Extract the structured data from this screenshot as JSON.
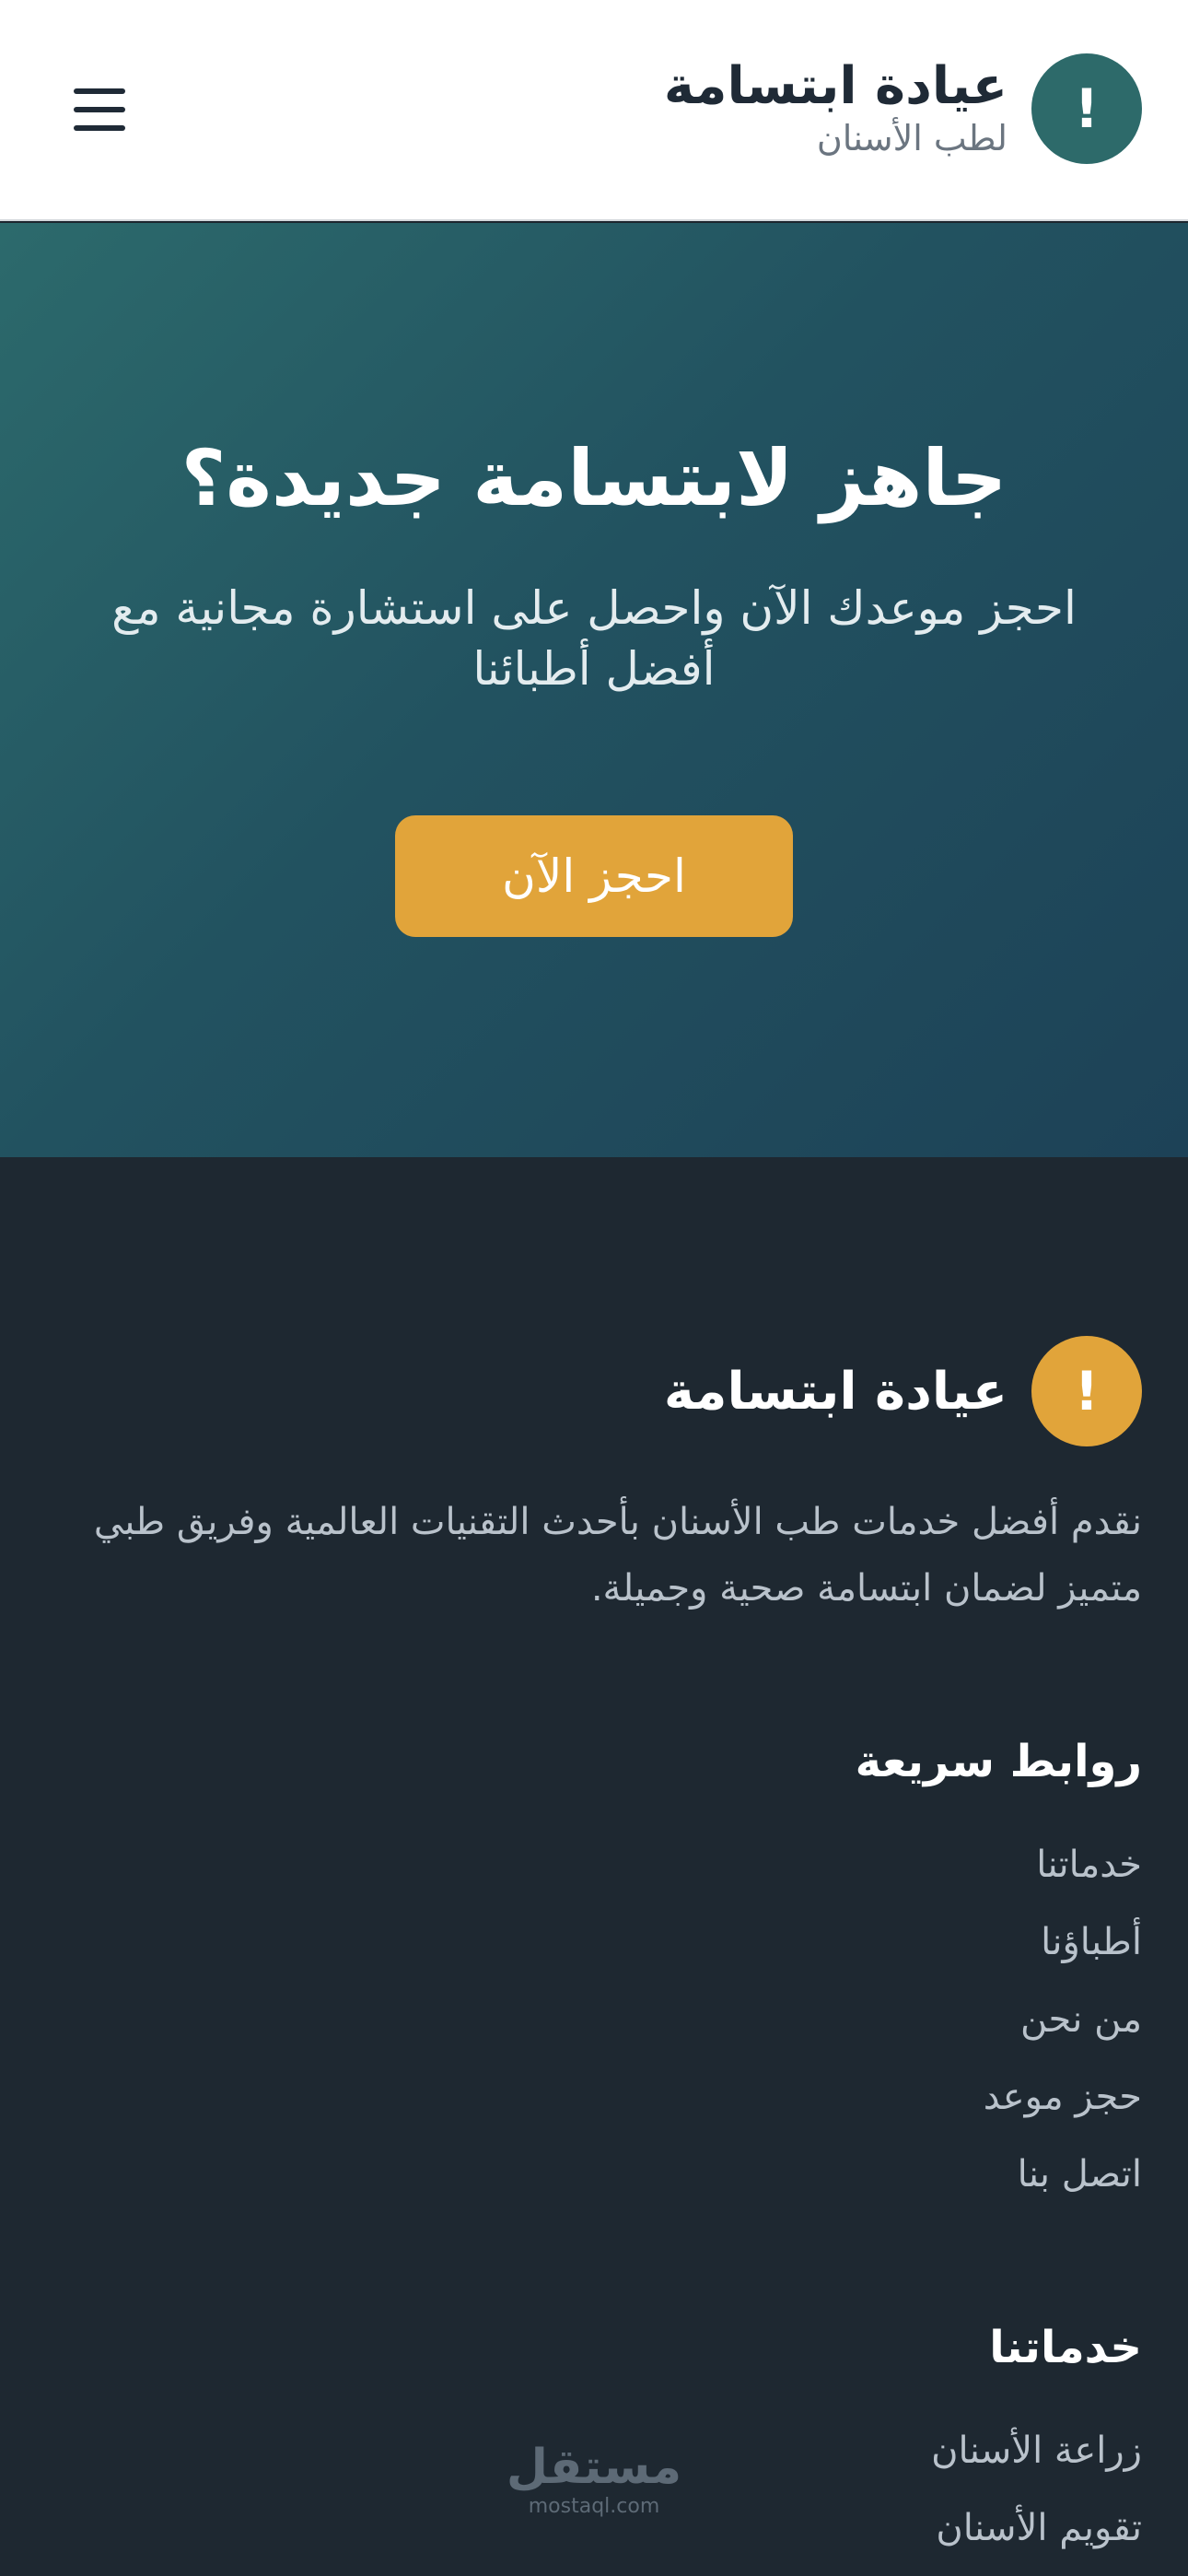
{
  "header": {
    "logo_glyph": "!",
    "title": "عيادة ابتسامة",
    "subtitle": "لطب الأسنان",
    "menu_icon": "hamburger-menu-icon"
  },
  "hero": {
    "title": "جاهز لابتسامة جديدة؟",
    "description": "احجز موعدك الآن واحصل على استشارة مجانية مع أفضل أطبائنا",
    "cta_label": "احجز الآن"
  },
  "footer": {
    "logo_glyph": "!",
    "title": "عيادة ابتسامة",
    "description": "نقدم أفضل خدمات طب الأسنان بأحدث التقنيات العالمية وفريق طبي متميز لضمان ابتسامة صحية وجميلة.",
    "quick_links": {
      "heading": "روابط سريعة",
      "items": [
        "خدماتنا",
        "أطباؤنا",
        "من نحن",
        "حجز موعد",
        "اتصل بنا"
      ]
    },
    "services": {
      "heading": "خدماتنا",
      "items": [
        "زراعة الأسنان",
        "تقويم الأسنان"
      ]
    }
  },
  "watermark": {
    "arabic": "مستقل",
    "latin": "mostaql.com"
  },
  "colors": {
    "primary_teal": "#2d6a6a",
    "accent_gold": "#e1a43a",
    "footer_bg": "#1e2831",
    "hero_gradient_start": "#2c6a6c",
    "hero_gradient_end": "#1d4257"
  }
}
